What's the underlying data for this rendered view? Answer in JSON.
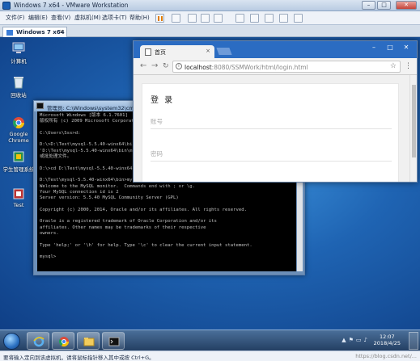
{
  "vm": {
    "title": "Windows 7 x64 - VMware Workstation",
    "menus": [
      "文件(F)",
      "编辑(E)",
      "查看(V)",
      "虚拟机(M)",
      "选项卡(T)",
      "帮助(H)"
    ],
    "tab_label": "Windows 7 x64",
    "status_text": "要将输入定向到该虚拟机，请将鼠标指针移入其中或按 Ctrl+G。",
    "watermark": "https://blog.csdn.net/..."
  },
  "desktop": {
    "icons": [
      {
        "label": "计算机",
        "icon": "computer-icon"
      },
      {
        "label": "回收站",
        "icon": "recycle-bin-icon"
      },
      {
        "label": "Google Chrome",
        "icon": "chrome-icon"
      },
      {
        "label": "学生管理系统",
        "icon": "app-icon"
      },
      {
        "label": "Test",
        "icon": "app-icon"
      }
    ]
  },
  "cmd": {
    "title": "管理员: C:\\Windows\\system32\\cmd.exe - mysql -u root -p",
    "lines": [
      "Microsoft Windows [版本 6.1.7601]",
      "版权所有 (c) 2009 Microsoft Corporation。保留所有权利。",
      "",
      "C:\\Users\\Sss>d:",
      "",
      "D:\\>D:\\Test\\mysql-5.5.40-winx64\\bin\\mysql.exe",
      "'D:\\Test\\mysql-5.5.40-winx64\\bin\\mysql.exe' 不是内部或外部命令，也不是可运行的程序",
      "或批处理文件。",
      "",
      "D:\\>cd D:\\Test\\mysql-5.5.40-winx64\\bin",
      "",
      "D:\\Test\\mysql-5.5.40-winx64\\bin>mysql -uroot -proot",
      "Welcome to the MySQL monitor.  Commands end with ; or \\g.",
      "Your MySQL connection id is 2",
      "Server version: 5.5.40 MySQL Community Server (GPL)",
      "",
      "Copyright (c) 2000, 2014, Oracle and/or its affiliates. All rights reserved.",
      "",
      "Oracle is a registered trademark of Oracle Corporation and/or its",
      "affiliates. Other names may be trademarks of their respective",
      "owners.",
      "",
      "Type 'help;' or '\\h' for help. Type '\\c' to clear the current input statement.",
      "",
      "mysql>"
    ]
  },
  "chrome": {
    "tab_title": "首页",
    "url_host": "localhost",
    "url_path": ":8080/SSMWork/html/login.html",
    "login": {
      "title": "登 录",
      "account_placeholder": "账号",
      "password_placeholder": "密码"
    }
  },
  "taskbar": {
    "time": "12:07",
    "date": "2018/4/25"
  }
}
